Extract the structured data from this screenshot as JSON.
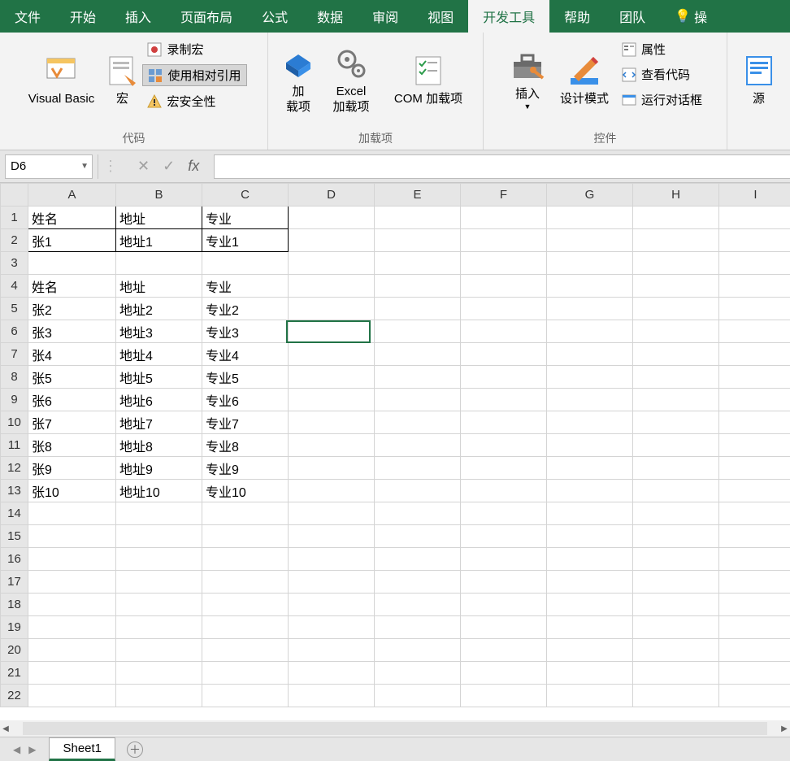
{
  "tabs": {
    "items": [
      "文件",
      "开始",
      "插入",
      "页面布局",
      "公式",
      "数据",
      "审阅",
      "视图",
      "开发工具",
      "帮助",
      "团队"
    ],
    "bulb": "操",
    "active": 8
  },
  "ribbon": {
    "code": {
      "label": "代码",
      "vb": "Visual Basic",
      "macros": "宏",
      "record": "录制宏",
      "relative": "使用相对引用",
      "security": "宏安全性"
    },
    "addins": {
      "label": "加载项",
      "addin1": "加\n载项",
      "addin2": "Excel\n加载项",
      "addin3": "COM 加载项"
    },
    "controls": {
      "label": "控件",
      "insert": "插入",
      "design": "设计模式",
      "props": "属性",
      "viewcode": "查看代码",
      "dialog": "运行对话框"
    },
    "xml": {
      "label": "",
      "source": "源"
    }
  },
  "formula": {
    "cellref": "D6",
    "fx": "fx"
  },
  "columns": [
    "A",
    "B",
    "C",
    "D",
    "E",
    "F",
    "G",
    "H",
    "I"
  ],
  "rowcount": 22,
  "cells": {
    "1": {
      "A": "姓名",
      "B": "地址",
      "C": "专业"
    },
    "2": {
      "A": "张1",
      "B": "地址1",
      "C": "专业1"
    },
    "4": {
      "A": "姓名",
      "B": "地址",
      "C": "专业"
    },
    "5": {
      "A": "张2",
      "B": "地址2",
      "C": "专业2"
    },
    "6": {
      "A": "张3",
      "B": "地址3",
      "C": "专业3"
    },
    "7": {
      "A": "张4",
      "B": "地址4",
      "C": "专业4"
    },
    "8": {
      "A": "张5",
      "B": "地址5",
      "C": "专业5"
    },
    "9": {
      "A": "张6",
      "B": "地址6",
      "C": "专业6"
    },
    "10": {
      "A": "张7",
      "B": "地址7",
      "C": "专业7"
    },
    "11": {
      "A": "张8",
      "B": "地址8",
      "C": "专业8"
    },
    "12": {
      "A": "张9",
      "B": "地址9",
      "C": "专业9"
    },
    "13": {
      "A": "张10",
      "B": "地址10",
      "C": "专业10"
    }
  },
  "bordered_rows": [
    1,
    2
  ],
  "sheet": {
    "name": "Sheet1"
  }
}
